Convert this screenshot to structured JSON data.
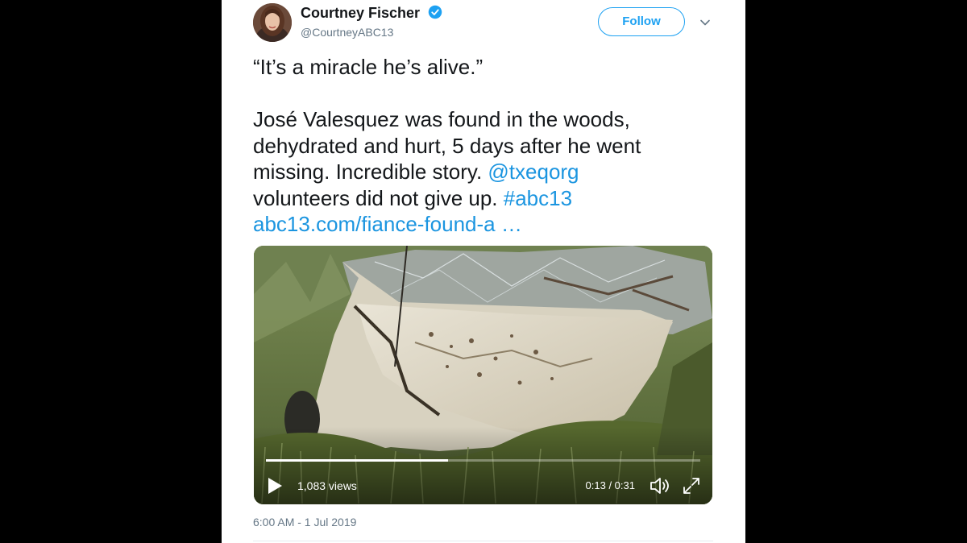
{
  "author": {
    "name": "Courtney Fischer",
    "handle": "@CourtneyABC13",
    "verified": true
  },
  "follow_label": "Follow",
  "tweet": {
    "quote": "“It’s a miracle he’s alive.”",
    "line1": "José Valesquez was found in the woods,",
    "line2": "dehydrated and hurt, 5 days after he went",
    "line3_text": "missing. Incredible story. ",
    "mention": "@txeqorg",
    "line4_text": "volunteers did not give up. ",
    "hashtag": "#abc13",
    "link": "abc13.com/fiance-found-a  …"
  },
  "video": {
    "views": "1,083 views",
    "time": "0:13 / 0:31",
    "progress": 0.42
  },
  "timestamp": "6:00 AM - 1 Jul 2019",
  "colors": {
    "link_blue": "#1b95e0",
    "follow_blue": "#1da1f2",
    "verified_blue": "#1da1f2"
  },
  "icons": [
    "verified-badge-icon",
    "chevron-down-icon",
    "play-icon",
    "volume-icon",
    "fullscreen-icon"
  ]
}
